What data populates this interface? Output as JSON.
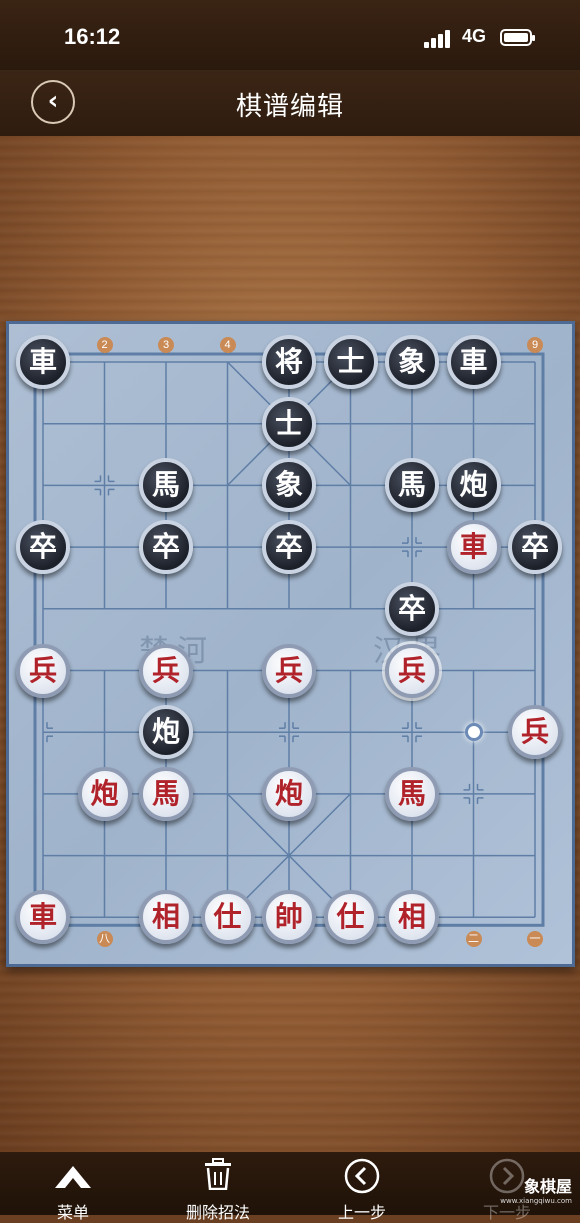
{
  "status_bar": {
    "time": "16:12",
    "network": "4G"
  },
  "header": {
    "title": "棋谱编辑",
    "back_icon": "chevron-left-icon"
  },
  "board": {
    "top_file_labels": [
      "2",
      "3",
      "4",
      "9"
    ],
    "bottom_file_labels": [
      "八",
      "二",
      "一"
    ],
    "river_left": "楚河",
    "river_right": "汉界",
    "target_marker": {
      "file": 7,
      "rank": 6
    },
    "pieces": [
      {
        "side": "black",
        "char": "車",
        "file": 0,
        "rank": 0
      },
      {
        "side": "black",
        "char": "将",
        "file": 4,
        "rank": 0
      },
      {
        "side": "black",
        "char": "士",
        "file": 5,
        "rank": 0
      },
      {
        "side": "black",
        "char": "象",
        "file": 6,
        "rank": 0
      },
      {
        "side": "black",
        "char": "車",
        "file": 7,
        "rank": 0
      },
      {
        "side": "black",
        "char": "士",
        "file": 4,
        "rank": 1
      },
      {
        "side": "black",
        "char": "馬",
        "file": 2,
        "rank": 2
      },
      {
        "side": "black",
        "char": "象",
        "file": 4,
        "rank": 2
      },
      {
        "side": "black",
        "char": "馬",
        "file": 6,
        "rank": 2
      },
      {
        "side": "black",
        "char": "炮",
        "file": 7,
        "rank": 2
      },
      {
        "side": "black",
        "char": "卒",
        "file": 0,
        "rank": 3
      },
      {
        "side": "black",
        "char": "卒",
        "file": 2,
        "rank": 3
      },
      {
        "side": "black",
        "char": "卒",
        "file": 4,
        "rank": 3
      },
      {
        "side": "red",
        "char": "車",
        "file": 7,
        "rank": 3
      },
      {
        "side": "black",
        "char": "卒",
        "file": 8,
        "rank": 3
      },
      {
        "side": "black",
        "char": "卒",
        "file": 6,
        "rank": 4
      },
      {
        "side": "red",
        "char": "兵",
        "file": 0,
        "rank": 5
      },
      {
        "side": "red",
        "char": "兵",
        "file": 2,
        "rank": 5
      },
      {
        "side": "red",
        "char": "兵",
        "file": 4,
        "rank": 5
      },
      {
        "side": "red",
        "char": "兵",
        "file": 6,
        "rank": 5,
        "selected": true
      },
      {
        "side": "black",
        "char": "炮",
        "file": 2,
        "rank": 6
      },
      {
        "side": "red",
        "char": "兵",
        "file": 8,
        "rank": 6
      },
      {
        "side": "red",
        "char": "炮",
        "file": 1,
        "rank": 7
      },
      {
        "side": "red",
        "char": "馬",
        "file": 2,
        "rank": 7
      },
      {
        "side": "red",
        "char": "炮",
        "file": 4,
        "rank": 7
      },
      {
        "side": "red",
        "char": "馬",
        "file": 6,
        "rank": 7
      },
      {
        "side": "red",
        "char": "車",
        "file": 0,
        "rank": 9
      },
      {
        "side": "red",
        "char": "相",
        "file": 2,
        "rank": 9
      },
      {
        "side": "red",
        "char": "仕",
        "file": 3,
        "rank": 9
      },
      {
        "side": "red",
        "char": "帥",
        "file": 4,
        "rank": 9
      },
      {
        "side": "red",
        "char": "仕",
        "file": 5,
        "rank": 9
      },
      {
        "side": "red",
        "char": "相",
        "file": 6,
        "rank": 9
      }
    ]
  },
  "toolbar": {
    "menu_label": "菜单",
    "delete_label": "删除招法",
    "prev_label": "上一步",
    "next_label": "下一步",
    "menu_icon": "menu-triangle-icon",
    "delete_icon": "trash-icon",
    "prev_icon": "chevron-left-circle-icon",
    "next_icon": "chevron-right-circle-icon"
  },
  "watermark": {
    "text": "象棋屋",
    "url": "www.xiangqiwu.com"
  }
}
